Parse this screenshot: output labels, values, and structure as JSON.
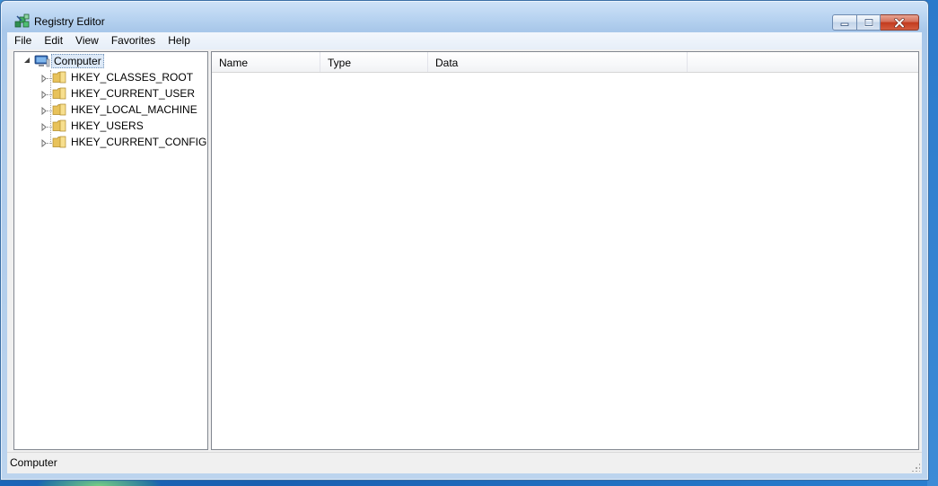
{
  "window": {
    "title": "Registry Editor",
    "icon": "regedit-icon"
  },
  "menu": {
    "items": [
      "File",
      "Edit",
      "View",
      "Favorites",
      "Help"
    ]
  },
  "tree": {
    "root": {
      "label": "Computer",
      "icon": "computer-icon",
      "expanded": true,
      "selected": true
    },
    "children": [
      {
        "label": "HKEY_CLASSES_ROOT",
        "icon": "folder-icon",
        "expanded": false
      },
      {
        "label": "HKEY_CURRENT_USER",
        "icon": "folder-icon",
        "expanded": false
      },
      {
        "label": "HKEY_LOCAL_MACHINE",
        "icon": "folder-icon",
        "expanded": false
      },
      {
        "label": "HKEY_USERS",
        "icon": "folder-icon",
        "expanded": false
      },
      {
        "label": "HKEY_CURRENT_CONFIG",
        "icon": "folder-icon",
        "expanded": false
      }
    ]
  },
  "list": {
    "columns": [
      "Name",
      "Type",
      "Data"
    ],
    "rows": []
  },
  "status": {
    "path": "Computer"
  },
  "colors": {
    "title_bar": "#b9d4f1",
    "close_button": "#c23a1e",
    "selection": "#dde9f7"
  }
}
